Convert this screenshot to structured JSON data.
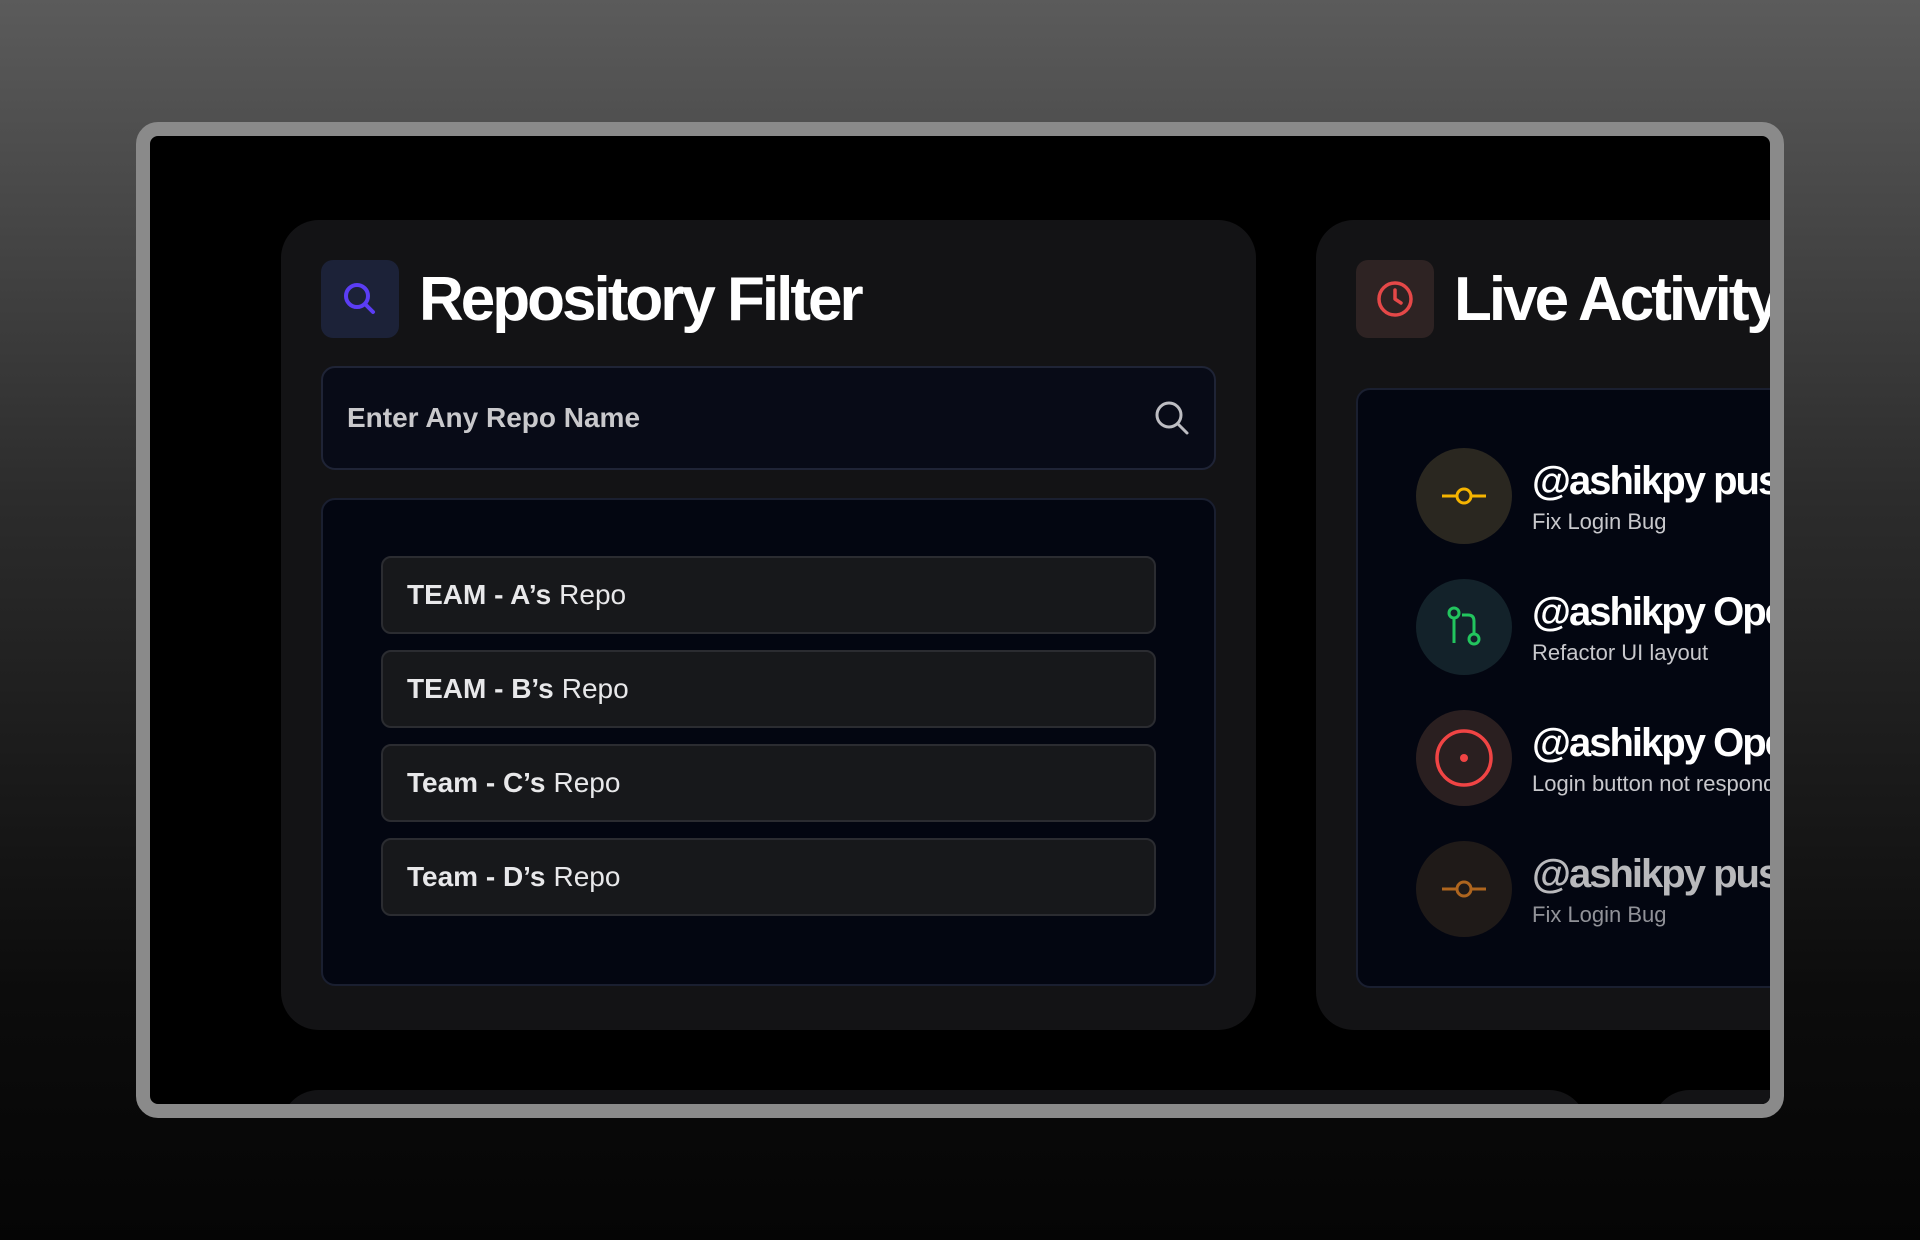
{
  "repo_panel": {
    "title": "Repository Filter",
    "search": {
      "placeholder": "Enter Any Repo Name",
      "value": ""
    },
    "repos": [
      {
        "team": "TEAM - A’s",
        "suffix": "Repo"
      },
      {
        "team": "TEAM - B’s",
        "suffix": "Repo"
      },
      {
        "team": "Team - C’s",
        "suffix": "Repo"
      },
      {
        "team": "Team - D’s",
        "suffix": "Repo"
      }
    ]
  },
  "live_panel": {
    "title": "Live Activity",
    "activities": [
      {
        "title": "@ashikpy pus",
        "subtitle": "Fix Login Bug",
        "icon": "commit-icon",
        "color": "#f5b400"
      },
      {
        "title": "@ashikpy Ope",
        "subtitle": "Refactor UI layout",
        "icon": "pull-request-icon",
        "color": "#22c55e"
      },
      {
        "title": "@ashikpy Ope",
        "subtitle": "Login button not respond",
        "icon": "issue-icon",
        "color": "#f04444"
      },
      {
        "title": "@ashikpy pus",
        "subtitle": "Fix Login Bug",
        "icon": "commit-icon",
        "color": "#f08a24"
      }
    ]
  },
  "colors": {
    "search_accent": "#5b3df5",
    "clock_accent": "#e54848"
  }
}
